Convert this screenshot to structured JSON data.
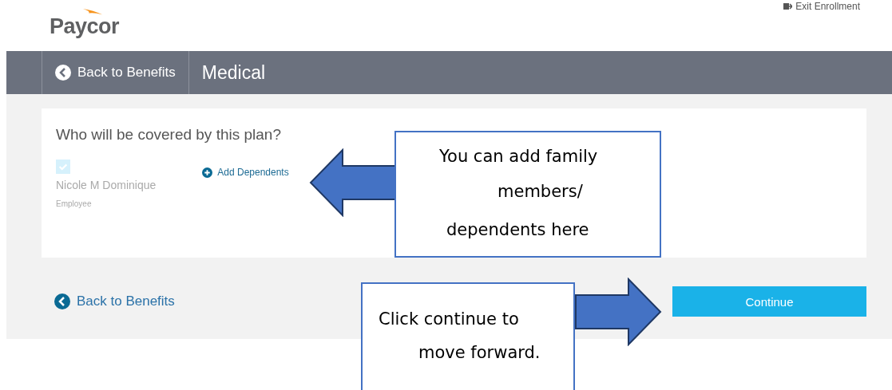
{
  "header": {
    "logo": "Paycor",
    "exit_link": "Exit Enrollment"
  },
  "nav_bar": {
    "back_link": "Back to Benefits",
    "title": "Medical"
  },
  "coverage": {
    "question": "Who will be covered by this plan?",
    "members": [
      {
        "name": "Nicole M Dominique",
        "role": "Employee",
        "checked": true
      }
    ],
    "add_link": "Add Dependents"
  },
  "footer": {
    "back_link": "Back to Benefits",
    "continue_button": "Continue"
  },
  "annotations": [
    {
      "kind": "left",
      "lines": [
        "You can add family",
        "members/",
        "dependents here"
      ]
    },
    {
      "kind": "right",
      "lines": [
        "Click continue to",
        "move forward."
      ]
    }
  ]
}
